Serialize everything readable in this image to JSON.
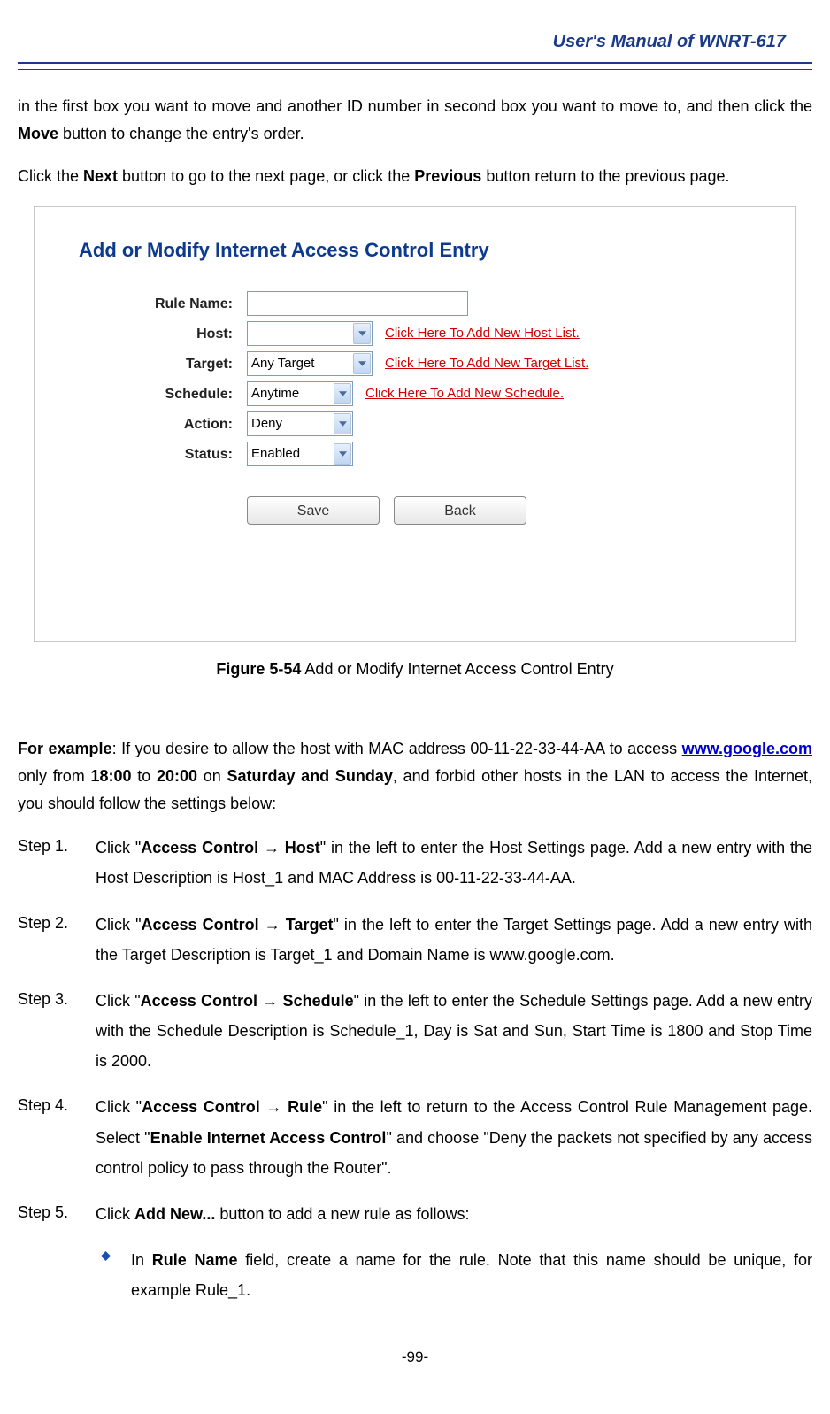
{
  "header": {
    "title": "User's Manual of WNRT-617"
  },
  "intro": {
    "para1_prefix": "in the first box you want to move and another ID number in second box you want to move to, and then click the ",
    "move_bold": "Move",
    "para1_suffix": " button to change the entry's order.",
    "para2_a": "Click the ",
    "next_bold": "Next",
    "para2_b": " button to go to the next page, or click the ",
    "prev_bold": "Previous",
    "para2_c": " button return to the previous page."
  },
  "screenshot": {
    "title": "Add or Modify Internet Access Control Entry",
    "labels": {
      "rule": "Rule Name:",
      "host": "Host:",
      "target": "Target:",
      "schedule": "Schedule:",
      "action": "Action:",
      "status": "Status:"
    },
    "values": {
      "rule": "",
      "host": "",
      "target": "Any Target",
      "schedule": "Anytime",
      "action": "Deny",
      "status": "Enabled"
    },
    "links": {
      "host": "Click Here To Add New Host List.",
      "target": "Click Here To Add New Target List.",
      "schedule": "Click Here To Add New Schedule."
    },
    "buttons": {
      "save": "Save",
      "back": "Back"
    }
  },
  "caption": {
    "fig_bold": "Figure 5-54",
    "fig_rest": "    Add or Modify Internet Access Control Entry"
  },
  "example": {
    "lead_bold": "For example",
    "lead_a": ": If you desire to allow the host with MAC address 00-11-22-33-44-AA to access ",
    "link": "www.google.com",
    "lead_b": " only from ",
    "t1": "18:00",
    "lead_c": " to ",
    "t2": "20:00",
    "lead_d": " on ",
    "days": "Saturday and Sunday",
    "lead_e": ", and forbid other hosts in the LAN to access the Internet, you should follow the settings below:"
  },
  "steps": {
    "s1_label": "Step 1.",
    "s1_a": "Click \"",
    "s1_bold": "Access Control → Host",
    "s1_b": "\" in the left to enter the Host Settings page. Add a new entry with the Host Description is Host_1 and MAC Address is 00-11-22-33-44-AA.",
    "s2_label": "Step 2.",
    "s2_a": "Click \"",
    "s2_bold": "Access Control → Target",
    "s2_b": "\" in the left to enter the Target Settings page. Add a new entry with the Target Description is Target_1 and Domain Name is www.google.com.",
    "s3_label": "Step 3.",
    "s3_a": "Click \"",
    "s3_bold": "Access Control → Schedule",
    "s3_b": "\" in the left to enter the Schedule Settings page. Add a new entry with the Schedule Description is Schedule_1, Day is Sat and Sun, Start Time is 1800 and Stop Time is 2000.",
    "s4_label": "Step 4.",
    "s4_a": "Click \"",
    "s4_bold1": "Access Control → Rule",
    "s4_b": "\" in the left to return to the Access Control Rule Management page. Select \"",
    "s4_bold2": "Enable Internet Access Control",
    "s4_c": "\" and choose \"Deny the packets not specified by any access control policy to pass through the Router\".",
    "s5_label": "Step 5.",
    "s5_a": "Click ",
    "s5_bold": "Add New...",
    "s5_b": " button to add a new rule as follows:"
  },
  "bullet": {
    "a": "In ",
    "bold": "Rule Name",
    "b": " field, create a name for the rule. Note that this name should be unique, for example Rule_1."
  },
  "page_num": "-99-"
}
